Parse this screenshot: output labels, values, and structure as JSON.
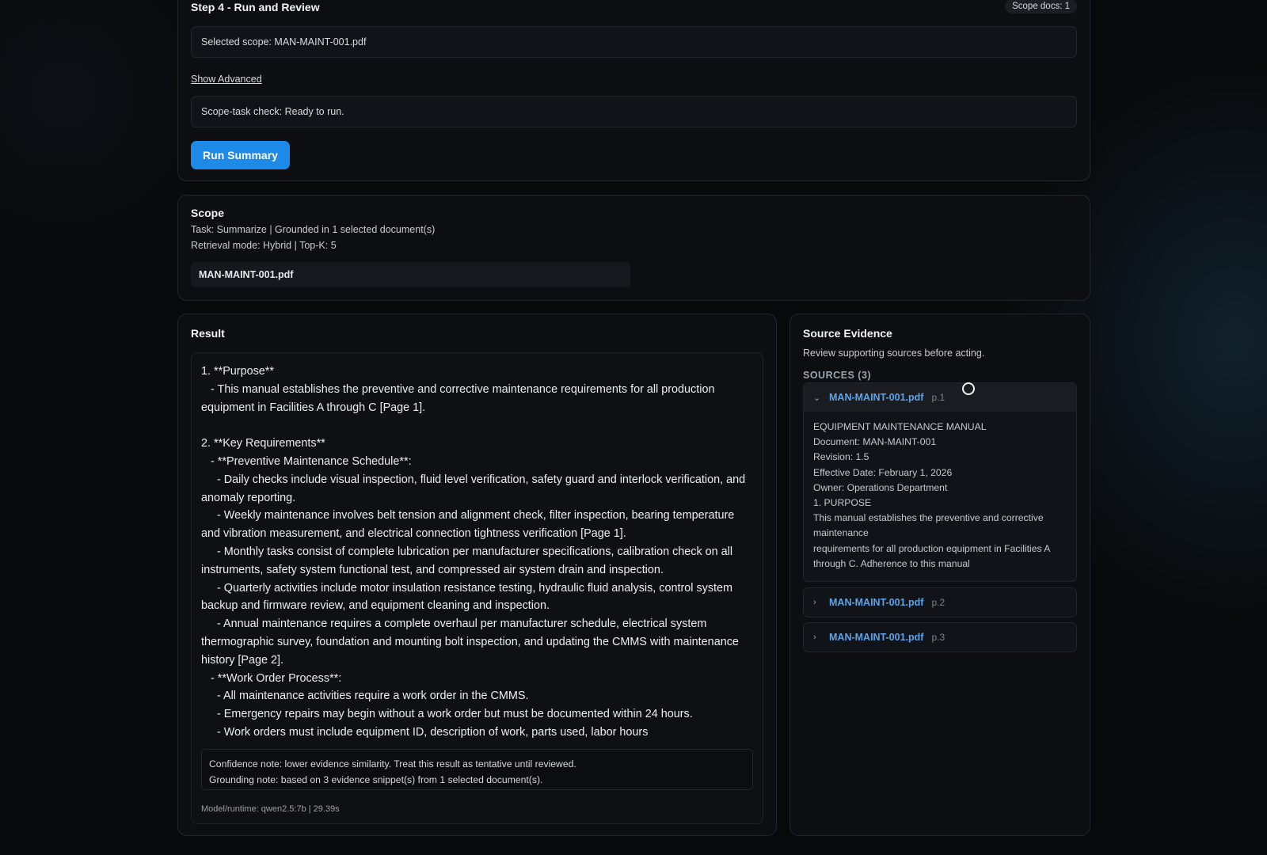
{
  "step4": {
    "title": "Step 4 - Run and Review",
    "scope_badge": "Scope docs: 1",
    "selected_scope": "Selected scope: MAN-MAINT-001.pdf",
    "show_advanced": "Show Advanced",
    "scope_check": "Scope-task check: Ready to run.",
    "run_button": "Run Summary"
  },
  "scope": {
    "title": "Scope",
    "task_line": "Task: Summarize | Grounded in 1 selected document(s)",
    "retrieval_line": "Retrieval mode: Hybrid | Top-K: 5",
    "document": "MAN-MAINT-001.pdf"
  },
  "result": {
    "title": "Result",
    "text": "1. **Purpose**\n   - This manual establishes the preventive and corrective maintenance requirements for all production equipment in Facilities A through C [Page 1].\n\n2. **Key Requirements**\n   - **Preventive Maintenance Schedule**:\n     - Daily checks include visual inspection, fluid level verification, safety guard and interlock verification, and anomaly reporting.\n     - Weekly maintenance involves belt tension and alignment check, filter inspection, bearing temperature and vibration measurement, and electrical connection tightness verification [Page 1].\n     - Monthly tasks consist of complete lubrication per manufacturer specifications, calibration check on all instruments, safety system functional test, and compressed air system drain and inspection.\n     - Quarterly activities include motor insulation resistance testing, hydraulic fluid analysis, control system backup and firmware review, and equipment cleaning and inspection.\n     - Annual maintenance requires a complete overhaul per manufacturer schedule, electrical system thermographic survey, foundation and mounting bolt inspection, and updating the CMMS with maintenance history [Page 2].\n   - **Work Order Process**:\n     - All maintenance activities require a work order in the CMMS.\n     - Emergency repairs may begin without a work order but must be documented within 24 hours.\n     - Work orders must include equipment ID, description of work, parts used, labor hours",
    "confidence_note": "Confidence note: lower evidence similarity. Treat this result as tentative until reviewed.",
    "grounding_note": "Grounding note: based on 3 evidence snippet(s) from 1 selected document(s).",
    "model_runtime": "Model/runtime: qwen2.5:7b | 29.39s"
  },
  "sources": {
    "title": "Source Evidence",
    "subtitle": "Review supporting sources before acting.",
    "heading": "SOURCES (3)",
    "items": [
      {
        "name": "MAN-MAINT-001.pdf",
        "page": "p.1",
        "icon": "chevron-down-icon",
        "excerpt": [
          "EQUIPMENT MAINTENANCE MANUAL",
          "Document: MAN-MAINT-001",
          "Revision: 1.5",
          "Effective Date: February 1, 2026",
          "Owner: Operations Department",
          "1. PURPOSE",
          "This manual establishes the preventive and corrective maintenance",
          "requirements for all production equipment in Facilities A through C. Adherence to this manual"
        ]
      },
      {
        "name": "MAN-MAINT-001.pdf",
        "page": "p.2",
        "icon": "chevron-right-icon"
      },
      {
        "name": "MAN-MAINT-001.pdf",
        "page": "p.3",
        "icon": "chevron-right-icon"
      }
    ]
  }
}
